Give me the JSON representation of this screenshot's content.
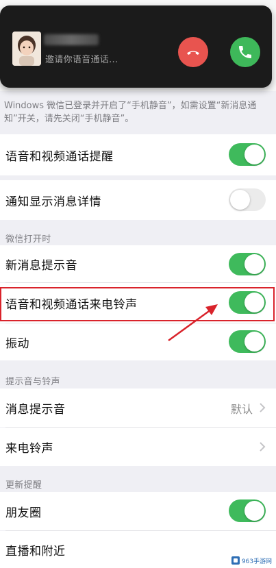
{
  "call_banner": {
    "invite_text": "邀请你语音通话..."
  },
  "notice": {
    "text": "Windows 微信已登录并开启了“手机静音”，如需设置“新消息通知”开关，请先关闭“手机静音”。"
  },
  "rows": {
    "voice_video_alert": {
      "label": "语音和视频通话提醒",
      "toggle_on": true
    },
    "show_message_detail": {
      "label": "通知显示消息详情",
      "toggle_on": false
    },
    "new_message_sound": {
      "label": "新消息提示音",
      "toggle_on": true
    },
    "voice_video_ringtone": {
      "label": "语音和视频通话来电铃声",
      "toggle_on": true
    },
    "vibration": {
      "label": "振动",
      "toggle_on": true
    },
    "message_sound": {
      "label": "消息提示音",
      "value": "默认"
    },
    "incoming_ringtone": {
      "label": "来电铃声"
    },
    "moments": {
      "label": "朋友圈",
      "toggle_on": true
    },
    "live_nearby": {
      "label": "直播和附近"
    }
  },
  "sections": {
    "when_wechat_open": "微信打开时",
    "sound_and_ringtone": "提示音与铃声",
    "update_reminder": "更新提醒"
  },
  "watermark": {
    "text": "963手游网"
  },
  "colors": {
    "toggle_on": "#3fba5c",
    "toggle_off": "#ebebeb",
    "decline": "#e8544f",
    "accept": "#3eb85a",
    "highlight": "#d9232b"
  }
}
